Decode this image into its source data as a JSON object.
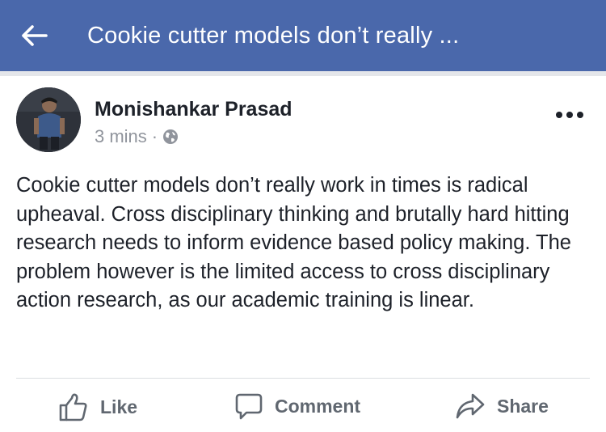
{
  "header": {
    "title": "Cookie cutter models don’t really ...",
    "back_icon": "arrow-left-icon",
    "background_color": "#4a68ab"
  },
  "post": {
    "author": "Monishankar Prasad",
    "time": "3 mins",
    "separator": "·",
    "privacy_icon": "globe-icon",
    "more_icon": "ellipsis-icon",
    "body": "Cookie cutter models don’t really work in times is radical upheaval. Cross disciplinary thinking and brutally hard hitting research needs to inform evidence based policy making. The problem however is the limited access to cross disciplinary action research, as our academic training is linear."
  },
  "actions": {
    "like": {
      "label": "Like",
      "icon": "thumbs-up-icon"
    },
    "comment": {
      "label": "Comment",
      "icon": "speech-bubble-icon"
    },
    "share": {
      "label": "Share",
      "icon": "share-arrow-icon"
    }
  }
}
